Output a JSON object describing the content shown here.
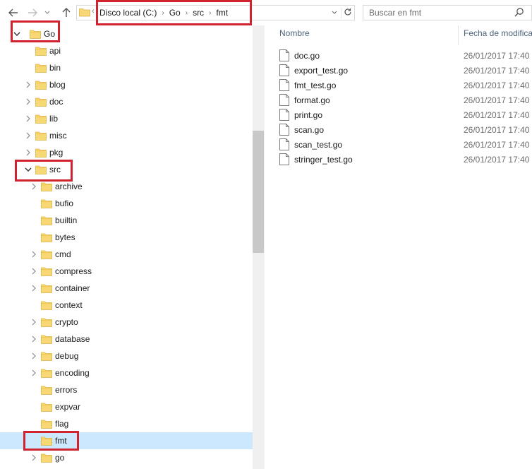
{
  "address": {
    "crumbs": [
      "Disco local (C:)",
      "Go",
      "src",
      "fmt"
    ]
  },
  "search": {
    "placeholder": "Buscar en fmt"
  },
  "columns": {
    "name": "Nombre",
    "date": "Fecha de modifica"
  },
  "tree": [
    {
      "label": "Go",
      "expanded": true,
      "has_children": true,
      "level": 0,
      "highlighted": true
    },
    {
      "label": "api",
      "has_children": false,
      "level": 1
    },
    {
      "label": "bin",
      "has_children": false,
      "level": 1
    },
    {
      "label": "blog",
      "has_children": true,
      "level": 1
    },
    {
      "label": "doc",
      "has_children": true,
      "level": 1
    },
    {
      "label": "lib",
      "has_children": true,
      "level": 1
    },
    {
      "label": "misc",
      "has_children": true,
      "level": 1
    },
    {
      "label": "pkg",
      "has_children": true,
      "level": 1
    },
    {
      "label": "src",
      "expanded": true,
      "has_children": true,
      "level": 1,
      "highlighted": true
    },
    {
      "label": "archive",
      "has_children": true,
      "level": 2
    },
    {
      "label": "bufio",
      "has_children": false,
      "level": 2
    },
    {
      "label": "builtin",
      "has_children": false,
      "level": 2
    },
    {
      "label": "bytes",
      "has_children": false,
      "level": 2
    },
    {
      "label": "cmd",
      "has_children": true,
      "level": 2
    },
    {
      "label": "compress",
      "has_children": true,
      "level": 2
    },
    {
      "label": "container",
      "has_children": true,
      "level": 2
    },
    {
      "label": "context",
      "has_children": false,
      "level": 2
    },
    {
      "label": "crypto",
      "has_children": true,
      "level": 2
    },
    {
      "label": "database",
      "has_children": true,
      "level": 2
    },
    {
      "label": "debug",
      "has_children": true,
      "level": 2
    },
    {
      "label": "encoding",
      "has_children": true,
      "level": 2
    },
    {
      "label": "errors",
      "has_children": false,
      "level": 2
    },
    {
      "label": "expvar",
      "has_children": false,
      "level": 2
    },
    {
      "label": "flag",
      "has_children": false,
      "level": 2
    },
    {
      "label": "fmt",
      "has_children": false,
      "level": 2,
      "selected": true,
      "highlighted": true
    },
    {
      "label": "go",
      "has_children": true,
      "level": 2
    }
  ],
  "files": [
    {
      "name": "doc.go",
      "date": "26/01/2017 17:40"
    },
    {
      "name": "export_test.go",
      "date": "26/01/2017 17:40"
    },
    {
      "name": "fmt_test.go",
      "date": "26/01/2017 17:40"
    },
    {
      "name": "format.go",
      "date": "26/01/2017 17:40"
    },
    {
      "name": "print.go",
      "date": "26/01/2017 17:40"
    },
    {
      "name": "scan.go",
      "date": "26/01/2017 17:40"
    },
    {
      "name": "scan_test.go",
      "date": "26/01/2017 17:40"
    },
    {
      "name": "stringer_test.go",
      "date": "26/01/2017 17:40"
    }
  ],
  "colors": {
    "highlight_border": "#d1222f",
    "selection": "#cce8ff",
    "folder": "#f8d775",
    "header_text": "#4c607a"
  }
}
